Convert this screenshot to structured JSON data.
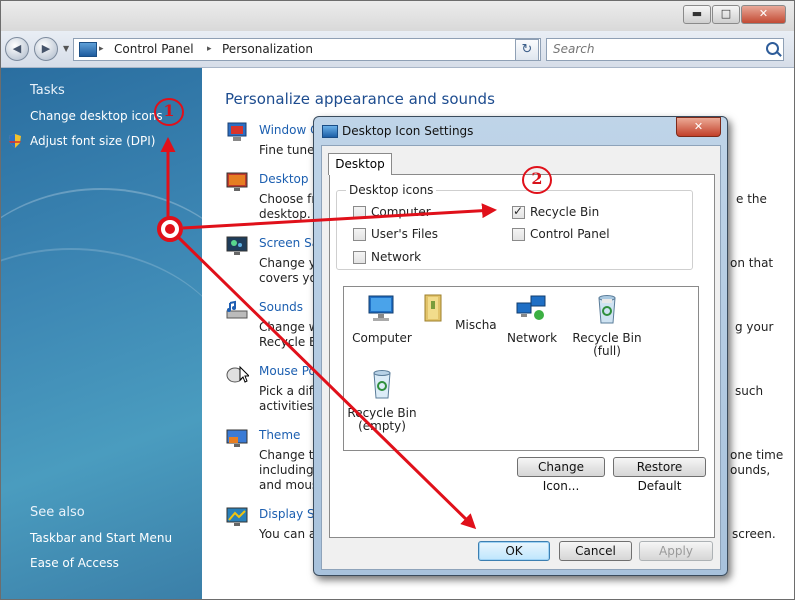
{
  "window": {
    "buttons": {
      "minimize": "▬",
      "maximize": "□",
      "close": "✕"
    }
  },
  "address": {
    "back_glyph": "◀",
    "forward_glyph": "▶",
    "breadcrumbs": [
      "Control Panel",
      "Personalization"
    ],
    "separator": "▸",
    "dropdown_glyph": "▼",
    "refresh_glyph": "↻",
    "search_placeholder": "Search"
  },
  "sidebar": {
    "tasks_heading": "Tasks",
    "tasks": [
      "Change desktop icons",
      "Adjust font size (DPI)"
    ],
    "see_also_heading": "See also",
    "see_also": [
      "Taskbar and Start Menu",
      "Ease of Access"
    ]
  },
  "main": {
    "title": "Personalize appearance and sounds",
    "items": [
      {
        "icon": "window-color-icon",
        "link": "Window C",
        "desc": [
          "Fine tune t"
        ]
      },
      {
        "icon": "desktop-background-icon",
        "link": "Desktop Ba",
        "desc": [
          "Choose fro",
          "desktop."
        ]
      },
      {
        "icon": "screen-saver-icon",
        "link": "Screen Sav",
        "desc": [
          "Change yo",
          "covers you"
        ]
      },
      {
        "icon": "sounds-icon",
        "link": "Sounds",
        "desc": [
          "Change wh",
          "Recycle Bi"
        ]
      },
      {
        "icon": "mouse-pointer-icon",
        "link": "Mouse Po",
        "desc": [
          "Pick a diffe",
          "activities a"
        ]
      },
      {
        "icon": "theme-icon",
        "link": "Theme",
        "desc": [
          "Change th",
          "including t",
          "and mouse"
        ]
      },
      {
        "icon": "display-settings-icon",
        "link": "Display Set",
        "desc": [
          "You can al"
        ]
      }
    ],
    "right_fragments": [
      "e the",
      "on that",
      "g your",
      "such",
      "one time",
      "ounds,",
      "screen."
    ]
  },
  "dialog": {
    "title": "Desktop Icon Settings",
    "close_glyph": "✕",
    "tab": "Desktop",
    "group_label": "Desktop icons",
    "checkboxes": [
      {
        "label": "Computer",
        "checked": false
      },
      {
        "label": "Recycle Bin",
        "checked": true
      },
      {
        "label": "User's Files",
        "checked": false
      },
      {
        "label": "Control Panel",
        "checked": false
      },
      {
        "label": "Network",
        "checked": false
      }
    ],
    "icons": [
      {
        "label": "Computer",
        "icon": "computer-icon"
      },
      {
        "label": "Mischa",
        "icon": "user-folder-icon"
      },
      {
        "label": "Network",
        "icon": "network-icon"
      },
      {
        "label": "Recycle Bin\n(full)",
        "icon": "recycle-bin-full-icon"
      },
      {
        "label": "Recycle Bin\n(empty)",
        "icon": "recycle-bin-empty-icon"
      }
    ],
    "change_icon_label": "Change Icon...",
    "restore_default_label": "Restore Default",
    "ok_label": "OK",
    "cancel_label": "Cancel",
    "apply_label": "Apply"
  },
  "annotations": {
    "step1": "1",
    "step2": "2",
    "color": "#e0101a"
  }
}
